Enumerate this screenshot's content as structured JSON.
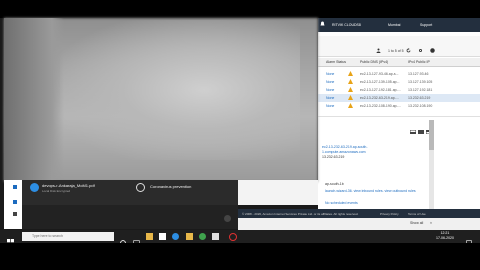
{
  "aws_nav": {
    "account": "RITVIK CLOUDS8",
    "region": "Mumbai",
    "support": "Support"
  },
  "toolbar": {
    "pager": "1 to 5 of 5"
  },
  "table": {
    "columns": [
      "Alarm Status",
      "Public DNS (IPv4)",
      "IPv4 Public IP"
    ],
    "rows": [
      {
        "status": "None",
        "dns": "ec2-13-127-93-46.ap-s...",
        "ip": "13.127.93.46",
        "selected": false
      },
      {
        "status": "None",
        "dns": "ec2-13-127-139-105.ap...",
        "ip": "13.127.139.105",
        "selected": false
      },
      {
        "status": "None",
        "dns": "ec2-13-127-192-181.ap-...",
        "ip": "13.127.192.181",
        "selected": false
      },
      {
        "status": "None",
        "dns": "ec2-13-232-63-219.ap-...",
        "ip": "13.232.63.219",
        "selected": true
      },
      {
        "status": "None",
        "dns": "ec2-13-232-108-190.ap-...",
        "ip": "13.232.108.190",
        "selected": false
      }
    ]
  },
  "details": {
    "line1": "ec2-13-232-63-219.ap-south-",
    "line2": "1.compute.amazonaws.com",
    "line3": "13.232.63.219",
    "availability_zone_label": "Availability zone",
    "availability_zone_value": "ap-south-1b",
    "security_groups_label": "Security groups",
    "security_groups_value": "launch-wizard-36. view inbound rules. view outbound rules",
    "scheduled_events_label": "Scheduled events",
    "scheduled_events_value": "No scheduled events"
  },
  "downloads": {
    "file_name": "devops-r-Ankaraja_MoM1.pdf",
    "file_status": "Local Disk Encrypted",
    "item2": "Coronavirus prevention"
  },
  "footer": {
    "copyright": "© 2008 - 2020, Amazon Internet Services Private Ltd. or its affiliates. All rights reserved.",
    "privacy": "Privacy Policy",
    "terms": "Terms of Use",
    "show_all": "Show all"
  },
  "taskbar": {
    "search_placeholder": "Type here to search",
    "time": "12:21",
    "date": "17-06-2020"
  },
  "colors": {
    "aws_dark": "#232f3e",
    "selected_row": "#dde8f5",
    "link": "#1c6bbf",
    "warning": "#e8a317"
  }
}
